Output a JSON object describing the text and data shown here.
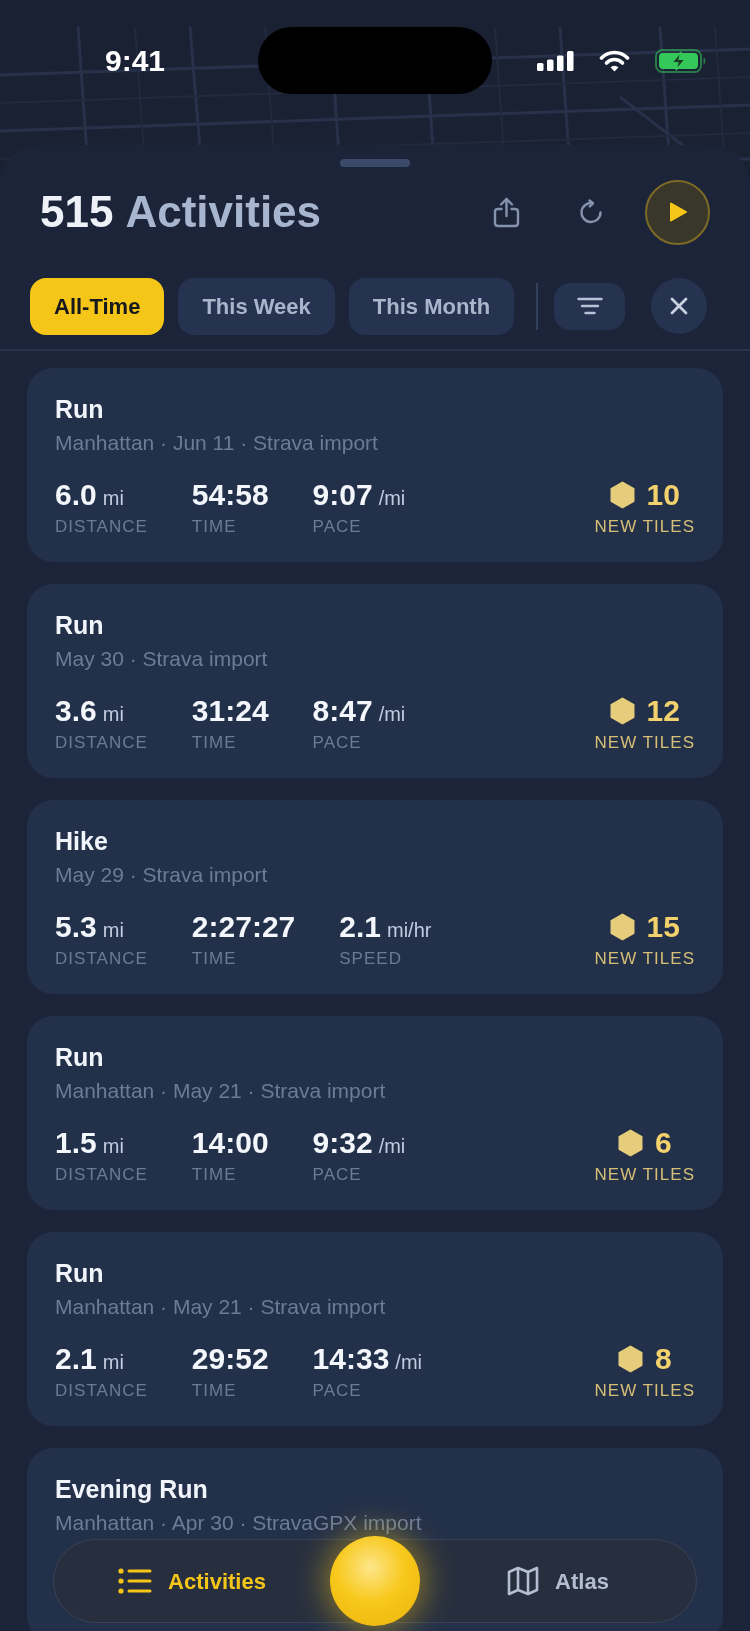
{
  "status_bar": {
    "time": "9:41"
  },
  "header": {
    "count": "515",
    "title": "Activities"
  },
  "filters": [
    {
      "label": "All-Time",
      "selected": true
    },
    {
      "label": "This Week",
      "selected": false
    },
    {
      "label": "This Month",
      "selected": false
    }
  ],
  "activities": [
    {
      "title": "Run",
      "details": "Manhattan · Jun 11 · Strava import",
      "stats": [
        {
          "value": "6.0",
          "unit": "mi",
          "label": "DISTANCE"
        },
        {
          "value": "54:58",
          "label": "TIME"
        },
        {
          "value": "9:07",
          "unit": "/mi",
          "label": "PACE"
        }
      ],
      "new_tiles": {
        "count": "10",
        "label": "NEW TILES"
      }
    },
    {
      "title": "Run",
      "details": "May 30 · Strava import",
      "stats": [
        {
          "value": "3.6",
          "unit": "mi",
          "label": "DISTANCE"
        },
        {
          "value": "31:24",
          "label": "TIME"
        },
        {
          "value": "8:47",
          "unit": "/mi",
          "label": "PACE"
        }
      ],
      "new_tiles": {
        "count": "12",
        "label": "NEW TILES"
      }
    },
    {
      "title": "Hike",
      "details": "May 29 · Strava import",
      "stats": [
        {
          "value": "5.3",
          "unit": "mi",
          "label": "DISTANCE"
        },
        {
          "value": "2:27:27",
          "label": "TIME"
        },
        {
          "value": "2.1",
          "unit": "mi/hr",
          "label": "SPEED"
        }
      ],
      "new_tiles": {
        "count": "15",
        "label": "NEW TILES"
      }
    },
    {
      "title": "Run",
      "details": "Manhattan · May 21 · Strava import",
      "stats": [
        {
          "value": "1.5",
          "unit": "mi",
          "label": "DISTANCE"
        },
        {
          "value": "14:00",
          "label": "TIME"
        },
        {
          "value": "9:32",
          "unit": "/mi",
          "label": "PACE"
        }
      ],
      "new_tiles": {
        "count": "6",
        "label": "NEW TILES"
      }
    },
    {
      "title": "Run",
      "details": "Manhattan · May 21 · Strava import",
      "stats": [
        {
          "value": "2.1",
          "unit": "mi",
          "label": "DISTANCE"
        },
        {
          "value": "29:52",
          "label": "TIME"
        },
        {
          "value": "14:33",
          "unit": "/mi",
          "label": "PACE"
        }
      ],
      "new_tiles": {
        "count": "8",
        "label": "NEW TILES"
      }
    },
    {
      "title": "Evening Run",
      "details": "Manhattan · Apr 30 · StravaGPX import"
    }
  ],
  "tab_bar": {
    "tabs": [
      {
        "label": "Activities",
        "selected": true
      },
      {
        "label": "Atlas",
        "selected": false
      }
    ]
  }
}
